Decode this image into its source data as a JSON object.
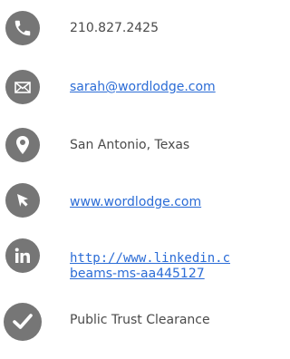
{
  "contacts": {
    "phone": {
      "icon": "phone-icon",
      "text": "210.827.2425"
    },
    "email": {
      "icon": "envelope-icon",
      "text": "sarah@wordlodge.com"
    },
    "location": {
      "icon": "map-pin-icon",
      "text": "San Antonio, Texas"
    },
    "website": {
      "icon": "cursor-arrow-icon",
      "text": "www.wordlodge.com"
    },
    "linkedin": {
      "icon": "linkedin-icon",
      "line1": "http://www.linkedin.c",
      "line2": "beams-ms-aa445127"
    },
    "clearance": {
      "icon": "checkmark-icon",
      "text": "Public Trust Clearance"
    }
  },
  "colors": {
    "icon_circle": "#767676",
    "text": "#4a4a4a",
    "link": "#2b6cd6"
  }
}
